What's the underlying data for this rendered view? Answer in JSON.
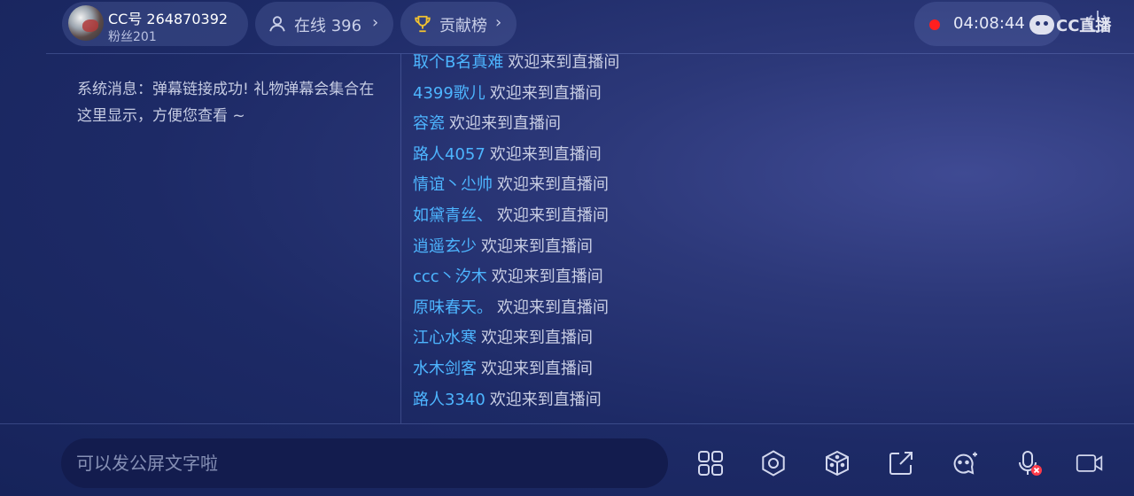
{
  "header": {
    "host_id": "CC号 264870392",
    "host_fans": "粉丝201",
    "online_label": "在线 396",
    "rank_label": "贡献榜",
    "chevron": "›",
    "timer": "04:08:44",
    "watermark_text": "CC直播"
  },
  "system_message": "系统消息：弹幕链接成功! 礼物弹幕会集合在这里显示，方便您查看 ~",
  "chat": [
    {
      "user": "取个B名真难",
      "msg": "欢迎来到直播间"
    },
    {
      "user": "4399歌儿",
      "msg": "欢迎来到直播间"
    },
    {
      "user": "容瓷",
      "msg": "欢迎来到直播间"
    },
    {
      "user": "路人4057",
      "msg": "欢迎来到直播间"
    },
    {
      "user": "情谊丶尐帅",
      "msg": "欢迎来到直播间"
    },
    {
      "user": "如黛青丝、",
      "msg": "欢迎来到直播间"
    },
    {
      "user": "逍遥玄少",
      "msg": "欢迎来到直播间"
    },
    {
      "user": "ccc丶汐木",
      "msg": "欢迎来到直播间"
    },
    {
      "user": "原味春天。",
      "msg": "欢迎来到直播间"
    },
    {
      "user": "江心水寒",
      "msg": "欢迎来到直播间"
    },
    {
      "user": "水木剑客",
      "msg": "欢迎来到直播间"
    },
    {
      "user": "路人3340",
      "msg": "欢迎来到直播间"
    }
  ],
  "input": {
    "placeholder": "可以发公屏文字啦"
  },
  "icons": {
    "online": "user-icon",
    "rank": "trophy-icon",
    "power": "power-icon",
    "tools": [
      "apps-grid-icon",
      "settings-gear-icon",
      "dice-icon",
      "share-icon",
      "add-friend-icon",
      "mic-muted-icon",
      "video-camera-icon"
    ]
  },
  "colors": {
    "username": "#4db5ff",
    "record": "#ff1f1f",
    "trophy": "#f2c230",
    "mic_muted_badge": "#ff3b4a"
  }
}
